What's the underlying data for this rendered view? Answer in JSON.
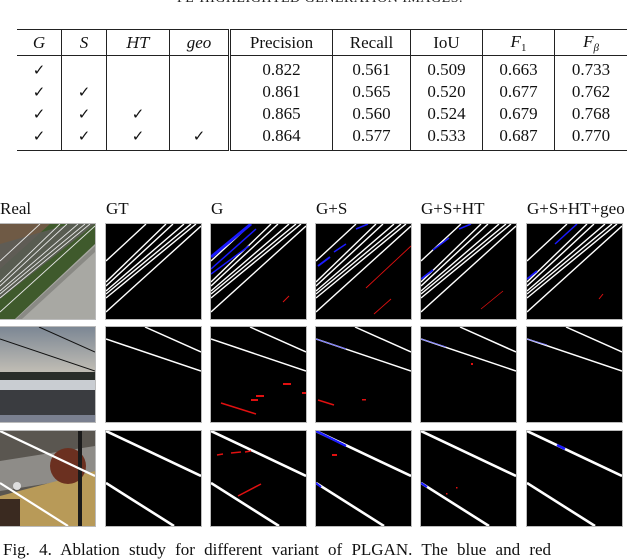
{
  "table": {
    "title_partial": "PL-HIGHLIGHTED GENERATION IMAGES.",
    "headers": {
      "g": "G",
      "s": "S",
      "ht": "HT",
      "geo": "geo",
      "precision": "Precision",
      "recall": "Recall",
      "iou": "IoU",
      "f1_base": "F",
      "f1_sub": "1",
      "fbeta_base": "F",
      "fbeta_sub": "β"
    },
    "check_glyph": "✓",
    "rows": [
      {
        "g": "✓",
        "s": "",
        "ht": "",
        "geo": "",
        "precision": "0.822",
        "recall": "0.561",
        "iou": "0.509",
        "f1": "0.663",
        "fbeta": "0.733"
      },
      {
        "g": "✓",
        "s": "✓",
        "ht": "",
        "geo": "",
        "precision": "0.861",
        "recall": "0.565",
        "iou": "0.520",
        "f1": "0.677",
        "fbeta": "0.762"
      },
      {
        "g": "✓",
        "s": "✓",
        "ht": "✓",
        "geo": "",
        "precision": "0.865",
        "recall": "0.560",
        "iou": "0.524",
        "f1": "0.679",
        "fbeta": "0.768"
      },
      {
        "g": "✓",
        "s": "✓",
        "ht": "✓",
        "geo": "✓",
        "precision": "0.864",
        "recall": "0.577",
        "iou": "0.533",
        "f1": "0.687",
        "fbeta": "0.770"
      }
    ]
  },
  "figure": {
    "column_labels": [
      "Real",
      "GT",
      "G",
      "G+S",
      "G+S+HT",
      "G+S+HT+geo"
    ],
    "colors": {
      "correct": "#ffffff",
      "missed": "#1a1aff",
      "false_positive": "#e01010",
      "background": "#000000"
    },
    "row_scenes": [
      "aerial railway with power lines",
      "overcast sky with power lines over building",
      "street with tree and lamp post"
    ]
  },
  "caption": {
    "text": "Fig. 4.  Ablation study for different variant of PLGAN. The blue and red"
  }
}
